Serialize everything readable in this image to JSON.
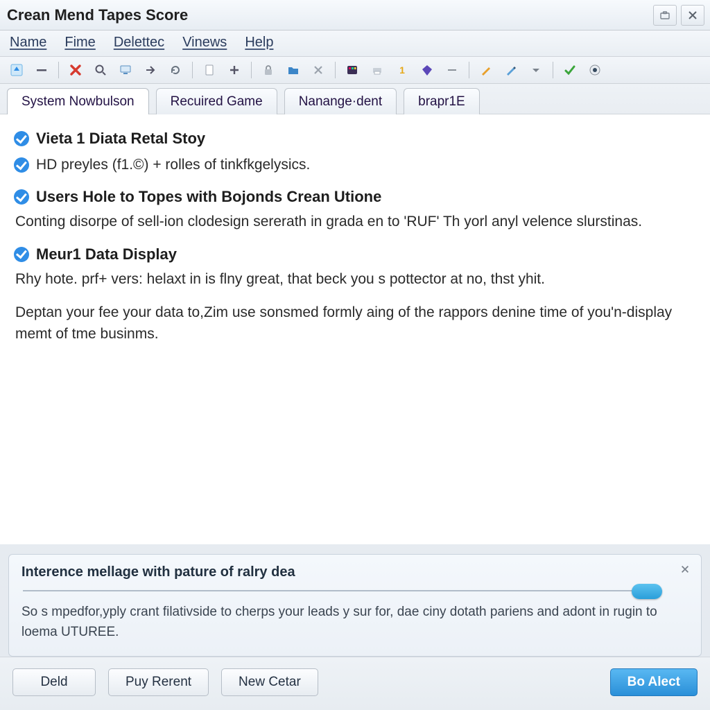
{
  "window": {
    "title": "Crean Mend Tapes Score"
  },
  "menu": {
    "name": "Name",
    "fime": "Fime",
    "delettec": "Delettec",
    "vinews": "Vinews",
    "help": "Help"
  },
  "toolbar_icons": {
    "up": "up-icon",
    "minus": "minus-icon",
    "x": "x-red-icon",
    "search": "search-icon",
    "monitor": "monitor-icon",
    "arrow": "arrow-right-icon",
    "refresh": "refresh-icon",
    "page": "page-icon",
    "plus": "plus-icon",
    "lock": "lock-icon",
    "folder": "folder-blue-icon",
    "cross": "cross-grey-icon",
    "palette": "palette-icon",
    "printer": "printer-icon",
    "one": "one-icon",
    "gem": "gem-icon",
    "dash": "dash-icon",
    "penA": "pen-icon",
    "penB": "pencil-icon",
    "caret": "caret-down-icon",
    "check": "check-green-icon",
    "eye": "eye-icon"
  },
  "tabs": [
    {
      "id": "system",
      "label": "System Nowbulson",
      "active": true
    },
    {
      "id": "recuired",
      "label": "Recuired Game",
      "active": false
    },
    {
      "id": "nanange",
      "label": "Nanange·dent",
      "active": false
    },
    {
      "id": "brapr",
      "label": "brapr1E",
      "active": false
    }
  ],
  "content": {
    "s1_title": "Vieta 1 Diata Retal Stoy",
    "s1_line": "HD preyles (f1.©) + rolles of tinkfkgelysics.",
    "s2_title": "Users Hole to Topes with Bojonds Crean Utione",
    "s2_body": "Conting disorpe of sell-ion clodesign sererath in grada en to 'RUF' Th yorl anyl velence slurstinas.",
    "s3_title": "Meur1 Data Display",
    "s3_body1": "Rhy hote. prf+ vers: helaxt in is flny great, that beck you s pottector at no, thst yhit.",
    "s3_body2": "Deptan your fee your data to,Zim use sonsmed formly aing of the rappors denine time of you'n-display memt of tme businms."
  },
  "notice": {
    "title": "Interence mellage with pature of ralry dea",
    "body": "So s mpedfor,yply crant filativside to cherps your leads y sur for, dae ciny dotath pariens and adont in rugin to loema UTUREE."
  },
  "footer": {
    "deld": "Deld",
    "puy": "Puy Rerent",
    "newc": "New Cetar",
    "primary": "Bo Alect"
  }
}
